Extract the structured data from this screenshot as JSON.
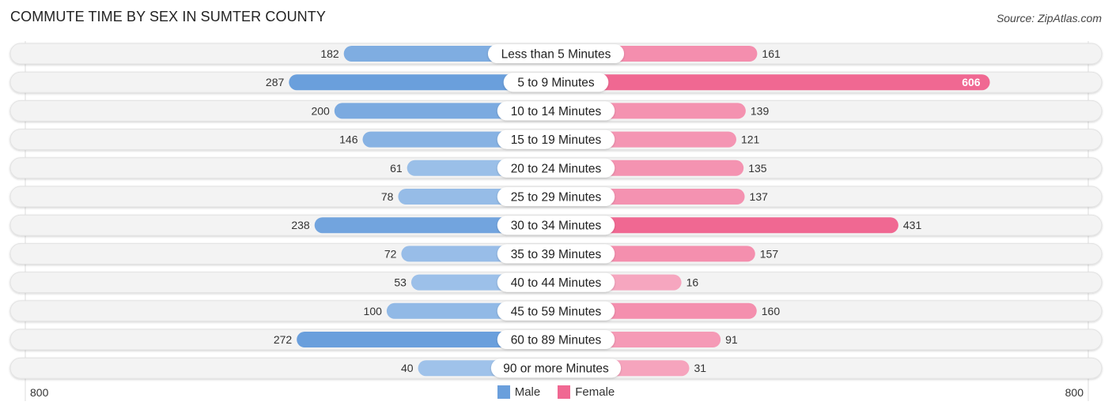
{
  "header": {
    "title": "COMMUTE TIME BY SEX IN SUMTER COUNTY",
    "source": "Source: ZipAtlas.com"
  },
  "colors": {
    "male": "#6a9fdc",
    "male_light": "#a8c8ec",
    "female": "#f06892",
    "female_light": "#f6a9c1",
    "row_bg": "#f3f3f3",
    "label_bg": "#ffffff"
  },
  "chart_data": {
    "type": "bar",
    "orientation": "horizontal-diverging",
    "title": "COMMUTE TIME BY SEX IN SUMTER COUNTY",
    "categories": [
      "Less than 5 Minutes",
      "5 to 9 Minutes",
      "10 to 14 Minutes",
      "15 to 19 Minutes",
      "20 to 24 Minutes",
      "25 to 29 Minutes",
      "30 to 34 Minutes",
      "35 to 39 Minutes",
      "40 to 44 Minutes",
      "45 to 59 Minutes",
      "60 to 89 Minutes",
      "90 or more Minutes"
    ],
    "series": [
      {
        "name": "Male",
        "side": "left",
        "values": [
          182,
          287,
          200,
          146,
          61,
          78,
          238,
          72,
          53,
          100,
          272,
          40
        ]
      },
      {
        "name": "Female",
        "side": "right",
        "values": [
          161,
          606,
          139,
          121,
          135,
          137,
          431,
          157,
          16,
          160,
          91,
          31
        ]
      }
    ],
    "axis": {
      "left_max_label": "800",
      "right_max_label": "800",
      "max": 800
    },
    "legend": {
      "entries": [
        "Male",
        "Female"
      ],
      "position": "bottom-center"
    },
    "grid": false
  }
}
